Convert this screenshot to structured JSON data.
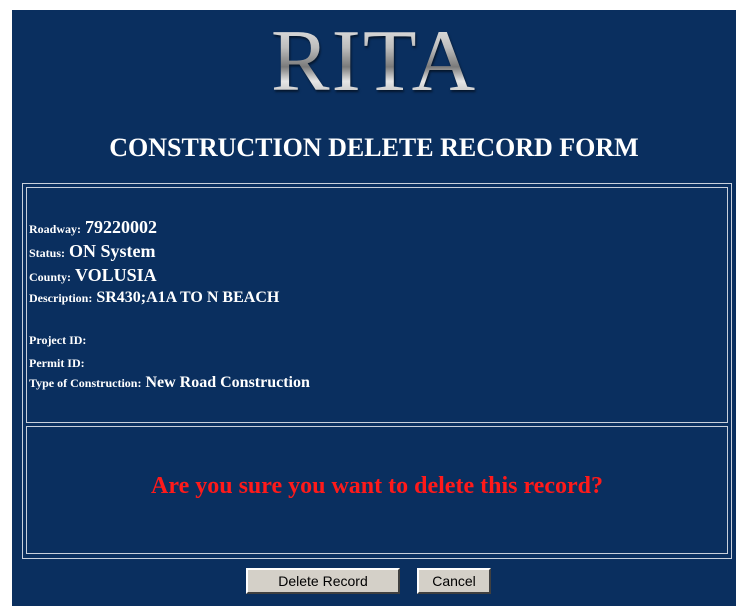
{
  "logo": {
    "text": "RITA"
  },
  "form_title": "CONSTRUCTION DELETE RECORD FORM",
  "record": {
    "roadway_label": "Roadway:",
    "roadway_value": "79220002",
    "status_label": "Status:",
    "status_value": "ON System",
    "county_label": "County:",
    "county_value": "VOLUSIA",
    "description_label": "Description:",
    "description_value": "SR430;A1A TO N BEACH",
    "project_id_label": "Project ID:",
    "project_id_value": "",
    "permit_id_label": "Permit ID:",
    "permit_id_value": "",
    "construction_type_label": "Type of Construction:",
    "construction_type_value": "New Road Construction"
  },
  "confirm_message": "Are you sure you want to delete this record?",
  "buttons": {
    "delete_label": "Delete Record",
    "cancel_label": "Cancel"
  },
  "colors": {
    "background": "#0a2f5f",
    "text": "#ffffff",
    "warning": "#ff1a1a",
    "button_face": "#d4d0c8"
  }
}
